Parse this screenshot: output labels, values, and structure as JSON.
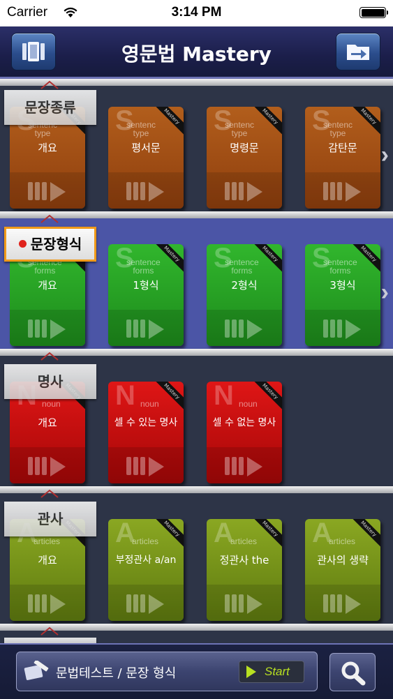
{
  "status_bar": {
    "carrier": "Carrier",
    "time": "3:14 PM"
  },
  "nav": {
    "title": "영문법 Mastery",
    "left_icon": "book-icon",
    "right_icon": "folder-arrow-icon"
  },
  "shelves": [
    {
      "label": "문장종류",
      "active": false,
      "color": "#9a4c16",
      "has_more": true,
      "books": [
        {
          "letter": "S",
          "sub1": "sentenc",
          "sub2": "type",
          "title": "개요"
        },
        {
          "letter": "S",
          "sub1": "sentenc",
          "sub2": "type",
          "title": "평서문"
        },
        {
          "letter": "S",
          "sub1": "sentenc",
          "sub2": "type",
          "title": "명령문"
        },
        {
          "letter": "S",
          "sub1": "sentenc",
          "sub2": "type",
          "title": "감탄문"
        }
      ]
    },
    {
      "label": "문장형식",
      "active": true,
      "color": "#29a827",
      "has_more": true,
      "books": [
        {
          "letter": "S",
          "sub1": "sentence",
          "sub2": "forms",
          "title": "개요"
        },
        {
          "letter": "S",
          "sub1": "sentence",
          "sub2": "forms",
          "title": "1형식"
        },
        {
          "letter": "S",
          "sub1": "sentence",
          "sub2": "forms",
          "title": "2형식"
        },
        {
          "letter": "S",
          "sub1": "sentence",
          "sub2": "forms",
          "title": "3형식"
        }
      ]
    },
    {
      "label": "명사",
      "active": false,
      "color": "#c90f0f",
      "has_more": false,
      "books": [
        {
          "letter": "N",
          "sub1": "noun",
          "sub2": "",
          "title": "개요"
        },
        {
          "letter": "N",
          "sub1": "noun",
          "sub2": "",
          "title": "셀 수 있는 명사"
        },
        {
          "letter": "N",
          "sub1": "noun",
          "sub2": "",
          "title": "셀 수 없는 명사"
        }
      ]
    },
    {
      "label": "관사",
      "active": false,
      "color": "#7e9a1c",
      "has_more": false,
      "books": [
        {
          "letter": "A",
          "sub1": "articles",
          "sub2": "",
          "title": "개요"
        },
        {
          "letter": "A",
          "sub1": "articles",
          "sub2": "",
          "title": "부정관사 a/an"
        },
        {
          "letter": "A",
          "sub1": "articles",
          "sub2": "",
          "title": "정관사 the"
        },
        {
          "letter": "A",
          "sub1": "articles",
          "sub2": "",
          "title": "관사의 생략"
        }
      ]
    }
  ],
  "book_ribbon": "Mastery",
  "bottom": {
    "test_label": "문법테스트 / 문장 형식",
    "start_label": "Start"
  }
}
